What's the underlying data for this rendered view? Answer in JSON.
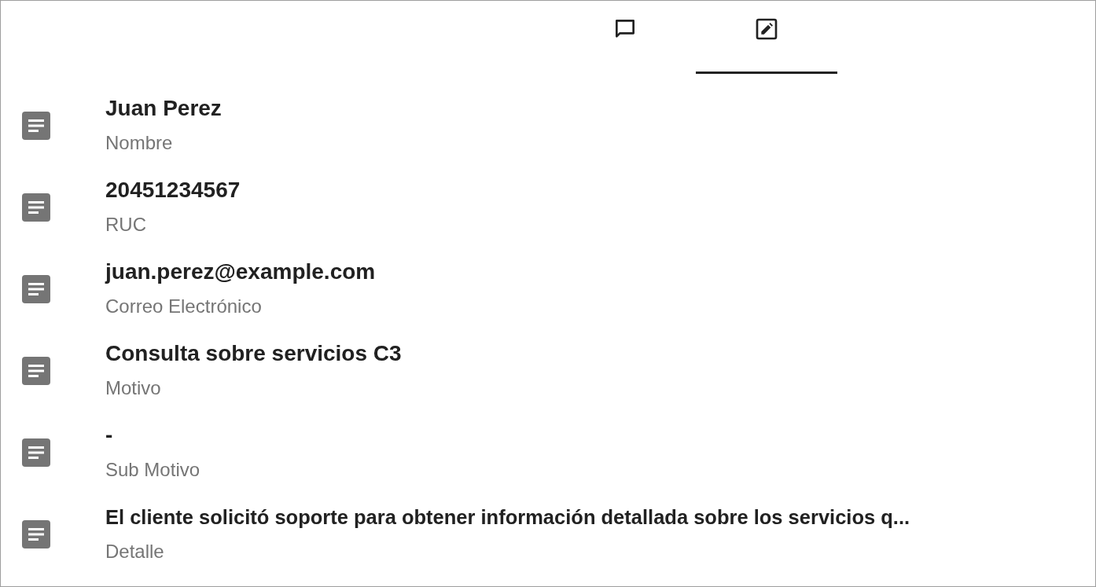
{
  "tabs": [
    {
      "kind": "chat",
      "selected": false
    },
    {
      "kind": "edit",
      "selected": true
    }
  ],
  "fields": [
    {
      "value": "Juan Perez",
      "label": "Nombre"
    },
    {
      "value": "20451234567",
      "label": "RUC"
    },
    {
      "value": "juan.perez@example.com",
      "label": "Correo Electrónico"
    },
    {
      "value": "Consulta sobre servicios C3",
      "label": "Motivo"
    },
    {
      "value": "-",
      "label": "Sub Motivo"
    },
    {
      "value": "El cliente solicitó soporte para obtener información detallada sobre los servicios q...",
      "label": "Detalle"
    }
  ]
}
